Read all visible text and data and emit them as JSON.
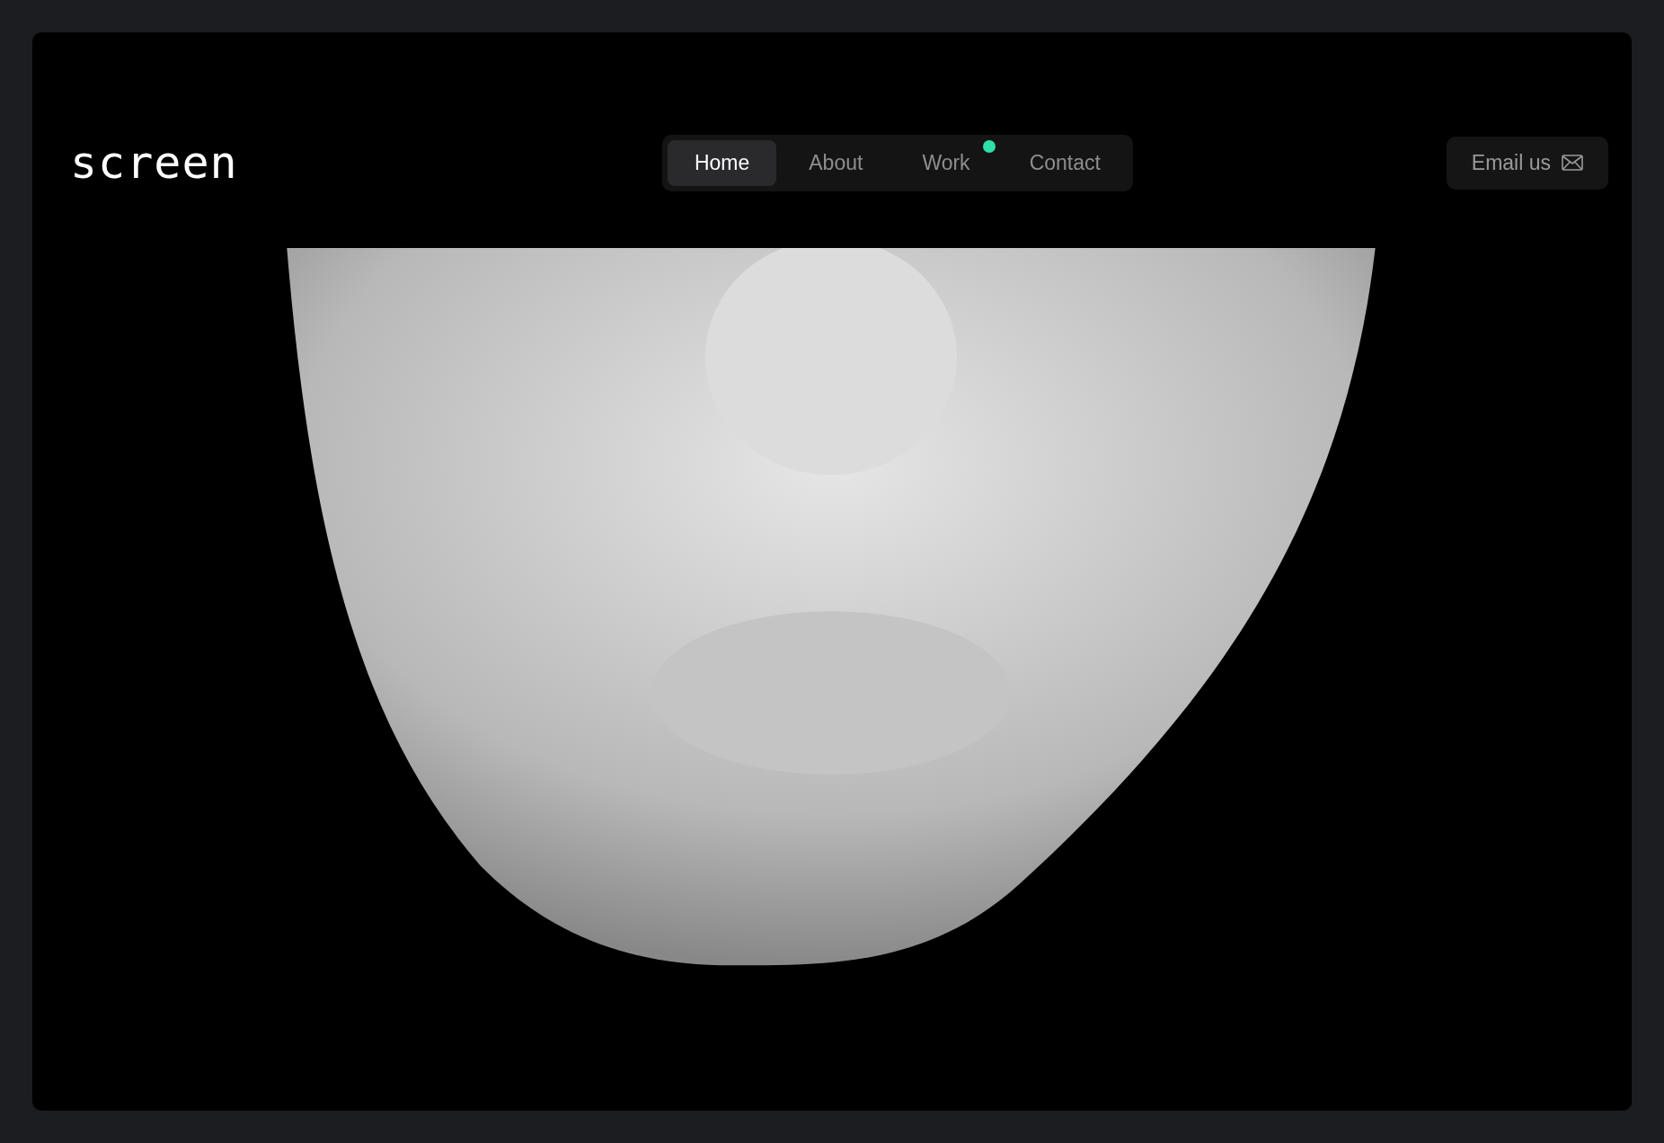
{
  "logo": "screen",
  "nav": [
    {
      "label": "Home",
      "selected": true,
      "dot": false
    },
    {
      "label": "About",
      "selected": false,
      "dot": false
    },
    {
      "label": "Work",
      "selected": false,
      "dot": true
    },
    {
      "label": "Contact",
      "selected": false,
      "dot": false
    }
  ],
  "email_button": {
    "label": "Email us"
  }
}
